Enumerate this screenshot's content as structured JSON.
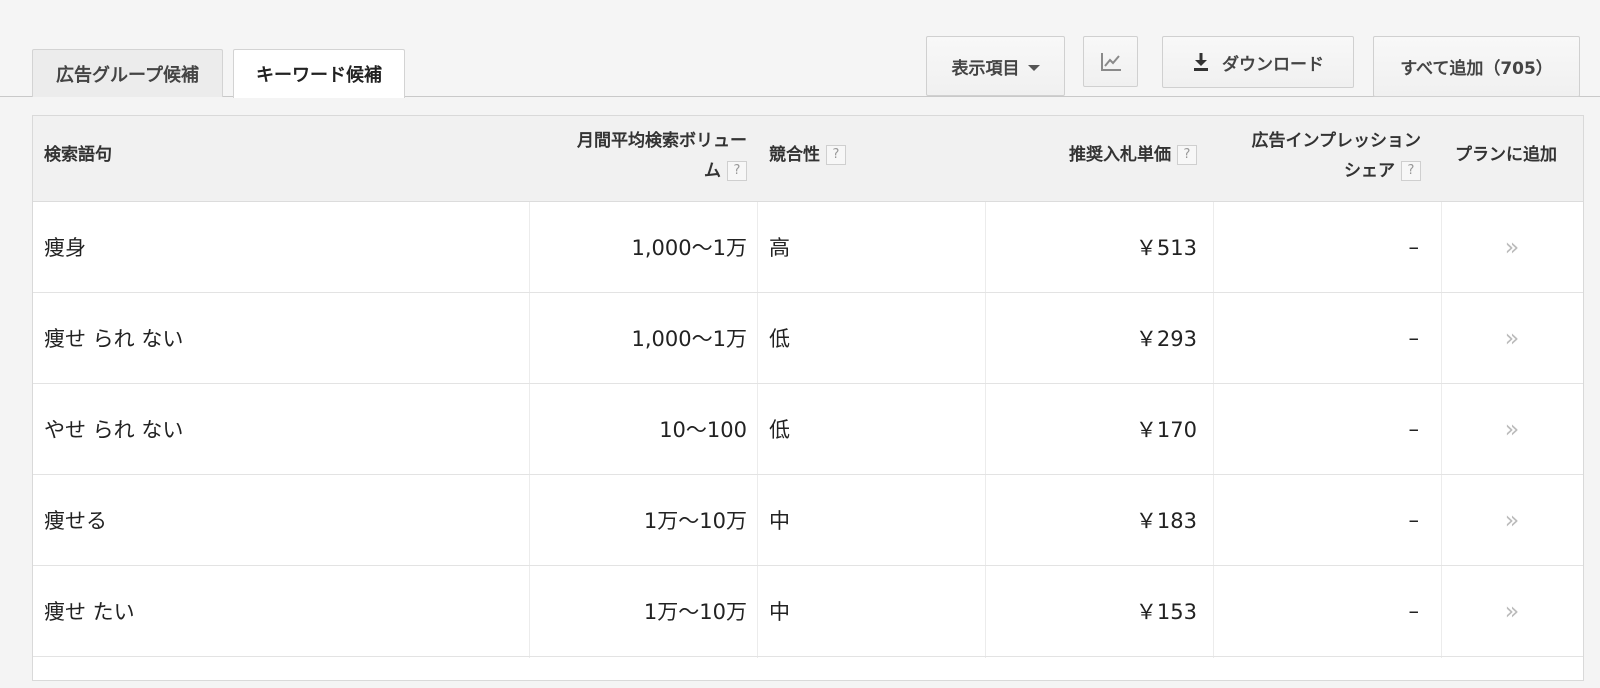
{
  "tabs": [
    {
      "label": "広告グループ候補"
    },
    {
      "label": "キーワード候補"
    }
  ],
  "toolbar": {
    "columns_label": "表示項目",
    "download_label": "ダウンロード",
    "add_all_label": "すべて追加（705）"
  },
  "icons": {
    "chart": "line-chart-icon",
    "download": "download-icon",
    "help": "?",
    "add_row": "»"
  },
  "table": {
    "headers": {
      "keyword": "検索語句",
      "volume_line1": "月間平均検索ボリュー",
      "volume_line2": "ム",
      "competition": "競合性",
      "bid": "推奨入札単価",
      "share_line1": "広告インプレッション",
      "share_line2": "シェア",
      "add": "プランに追加"
    },
    "rows": [
      {
        "keyword": "痩身",
        "volume": "1,000〜1万",
        "competition": "高",
        "bid": "￥513",
        "share": "–",
        "add": "»"
      },
      {
        "keyword": "痩せ られ ない",
        "volume": "1,000〜1万",
        "competition": "低",
        "bid": "￥293",
        "share": "–",
        "add": "»"
      },
      {
        "keyword": "やせ られ ない",
        "volume": "10〜100",
        "competition": "低",
        "bid": "￥170",
        "share": "–",
        "add": "»"
      },
      {
        "keyword": "痩せる",
        "volume": "1万〜10万",
        "competition": "中",
        "bid": "￥183",
        "share": "–",
        "add": "»"
      },
      {
        "keyword": "痩せ たい",
        "volume": "1万〜10万",
        "competition": "中",
        "bid": "￥153",
        "share": "–",
        "add": "»"
      }
    ]
  }
}
